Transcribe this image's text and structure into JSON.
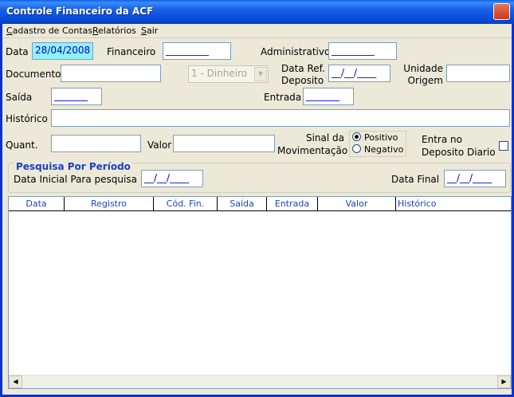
{
  "window": {
    "title": "Controle Financeiro da ACF"
  },
  "menu": {
    "items": [
      {
        "prefix": "",
        "hot": "C",
        "rest": "adastro de Contas"
      },
      {
        "prefix": "",
        "hot": "R",
        "rest": "elatórios"
      },
      {
        "prefix": "",
        "hot": "S",
        "rest": "air"
      }
    ]
  },
  "form": {
    "data_label": "Data",
    "data_value": "28/04/2008",
    "financeiro_label": "Financeiro",
    "financeiro_value": "_________",
    "administrativo_label": "Administrativo",
    "administrativo_value": "_________",
    "documento_label": "Documento",
    "documento_value": "",
    "forma_pagamento_value": "1 - Dinheiro",
    "data_ref_label_1": "Data Ref.",
    "data_ref_label_2": "Deposito",
    "data_ref_value": "__/__/____",
    "unidade_label_1": "Unidade",
    "unidade_label_2": "Origem",
    "unidade_value": "",
    "saida_label": "Saída",
    "saida_value": "_______",
    "entrada_label": "Entrada",
    "entrada_value": "_______",
    "historico_label": "Histórico",
    "historico_value": "",
    "quant_label": "Quant.",
    "quant_value": "",
    "valor_label": "Valor",
    "valor_value": "",
    "sinal_label_1": "Sinal da",
    "sinal_label_2": "Movimentação",
    "positivo_label": "Positivo",
    "negativo_label": "Negativo",
    "entra_label_1": "Entra no",
    "entra_label_2": "Deposito Diario"
  },
  "search": {
    "title": "Pesquisa Por Período",
    "inicial_label": "Data Inicial Para pesquisa",
    "inicial_value": "__/__/____",
    "final_label": "Data Final",
    "final_value": "__/__/____"
  },
  "grid": {
    "columns": [
      "Data",
      "Registro",
      "Cód. Fin.",
      "Saída",
      "Entrada",
      "Valor",
      "Histórico"
    ]
  }
}
